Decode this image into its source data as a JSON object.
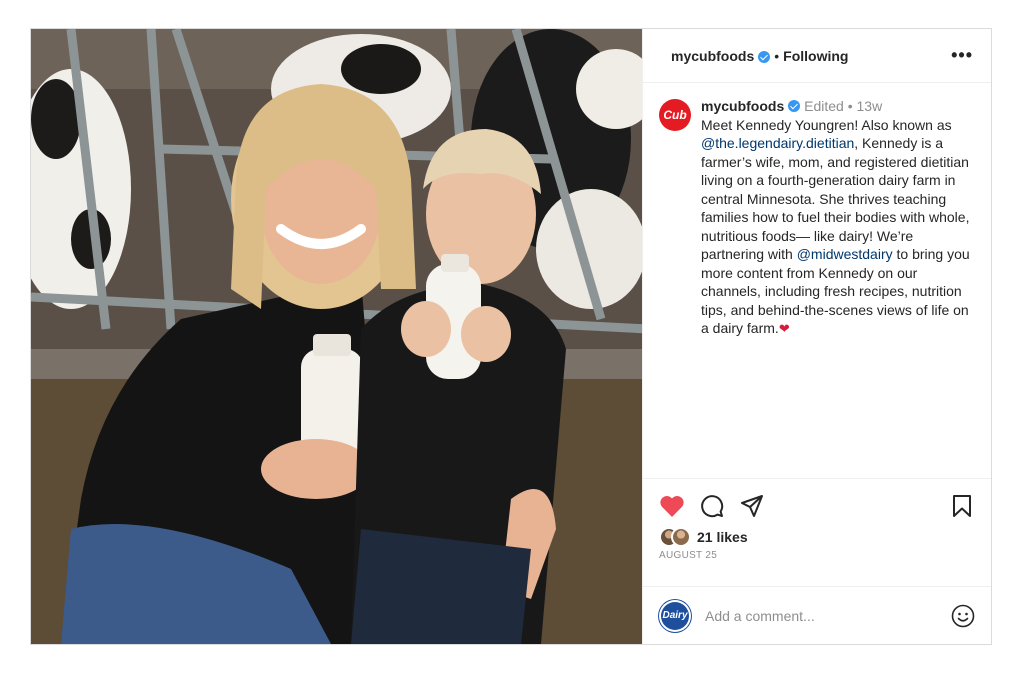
{
  "header": {
    "username": "mycubfoods",
    "separator": "•",
    "follow_status": "Following",
    "more": "•••"
  },
  "caption": {
    "avatar_text": "Cub",
    "username": "mycubfoods",
    "meta": "Edited • 13w",
    "text_1": "Meet Kennedy Youngren! Also known as ",
    "mention_1": "@the.legendairy.dietitian",
    "text_2": ", Kennedy is a farmer’s wife, mom, and registered dietitian living on a fourth-generation dairy farm in central Minnesota. She thrives teaching families how to fuel their bodies with whole, nutritious foods— like dairy! We’re partnering with ",
    "mention_2": "@midwestdairy",
    "text_3": " to bring you more content from Kennedy on our channels, including fresh recipes, nutrition tips, and behind-the-scenes views of life on a dairy farm.",
    "emoji": "❤"
  },
  "actions": {
    "like_icon": "heart-filled-icon",
    "comment_icon": "comment-icon",
    "share_icon": "paper-plane-icon",
    "save_icon": "bookmark-icon"
  },
  "likes": {
    "count_text": "21 likes"
  },
  "date": "AUGUST 25",
  "comment": {
    "avatar_text": "Dairy",
    "placeholder": "Add a comment..."
  },
  "colors": {
    "like": "#ed4956",
    "verified": "#3897f0",
    "brand_cub": "#e51b24",
    "mention": "#00376b"
  }
}
